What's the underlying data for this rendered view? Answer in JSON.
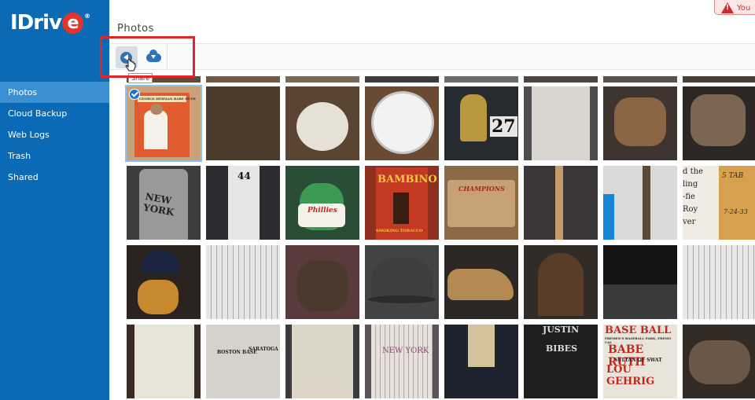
{
  "brand": {
    "logo_text": "IDriv",
    "logo_e": "e",
    "logo_reg": "®"
  },
  "sidebar": {
    "items": [
      {
        "label": "Photos",
        "active": true
      },
      {
        "label": "Cloud Backup",
        "active": false
      },
      {
        "label": "Web Logs",
        "active": false
      },
      {
        "label": "Trash",
        "active": false
      },
      {
        "label": "Shared",
        "active": false
      }
    ]
  },
  "header": {
    "title": "Photos",
    "alert_text": "You"
  },
  "toolbar": {
    "share_icon": "share-icon",
    "download_icon": "cloud-download-icon",
    "tooltip": "Share"
  },
  "colors": {
    "sidebar": "#0a6ab5",
    "sidebar_active": "#3c8fd1",
    "accent": "#1d73c9",
    "highlight": "#e0262b"
  },
  "photo_text": {
    "r1c1_card": "GEORGE HERMAN BABE RUTH",
    "r1c5_number": "27",
    "r2c1_text": "NEW YORK",
    "r2c2_number": "44",
    "r2c3_text": "Phillies",
    "r2c4_top": "BAMBINO",
    "r2c4_bottom": "SMOKING TOBACCO",
    "r2c5_text": "CHAMPIONS",
    "r2c8_line1": "d the",
    "r2c8_line2": "ling",
    "r2c8_line3": "-fie",
    "r2c8_line4": "Roy",
    "r2c8_line5": "ver",
    "r2c9_line1": "5  TAB",
    "r2c9_line2": "7-24-33",
    "r4c3_text": "BOSTON BASE",
    "r4c4_text": "SARATOGA",
    "r4c5_text": "NEW YORK",
    "r4c7_line1": "JUSTIN",
    "r4c7_line2": "BIBES",
    "r4c8_line1": "BASE BALL",
    "r4c8_line2": "FREMEN'S BASEBALL PARK, FREMO CAL",
    "r4c8_line3": "BABE RUTH",
    "r4c8_line4": "SULTAN OF SWAT",
    "r4c8_line5": "LOU GEHRIG"
  },
  "photos": [
    {
      "row": 0,
      "col": 0,
      "bg": "#c9a27a",
      "selected": true
    },
    {
      "row": 0,
      "col": 1,
      "bg": "#4a3b2d"
    },
    {
      "row": 0,
      "col": 2,
      "bg": "#5a4432"
    },
    {
      "row": 0,
      "col": 3,
      "bg": "#6b4a33"
    },
    {
      "row": 0,
      "col": 4,
      "bg": "#262b30"
    },
    {
      "row": 0,
      "col": 5,
      "bg": "#4d4d4d"
    },
    {
      "row": 0,
      "col": 6,
      "bg": "#3e3530"
    },
    {
      "row": 0,
      "col": 7,
      "bg": "#2d2825"
    },
    {
      "row": 1,
      "col": 0,
      "bg": "#3d3d3d"
    },
    {
      "row": 1,
      "col": 1,
      "bg": "#2c2c30"
    },
    {
      "row": 1,
      "col": 2,
      "bg": "#2a4d36"
    },
    {
      "row": 1,
      "col": 3,
      "bg": "#8e2f1f"
    },
    {
      "row": 1,
      "col": 4,
      "bg": "#8c6a46"
    },
    {
      "row": 1,
      "col": 5,
      "bg": "#3b3738"
    },
    {
      "row": 1,
      "col": 6,
      "bg": "#d9dad7"
    },
    {
      "row": 1,
      "col": 7,
      "bg": "#e8e2d6"
    },
    {
      "row": 2,
      "col": 0,
      "bg": "#2a2320"
    },
    {
      "row": 2,
      "col": 1,
      "bg": "#3a3a3a"
    },
    {
      "row": 2,
      "col": 2,
      "bg": "#5a3a3a"
    },
    {
      "row": 2,
      "col": 3,
      "bg": "#414344"
    },
    {
      "row": 2,
      "col": 4,
      "bg": "#2c2826"
    },
    {
      "row": 2,
      "col": 5,
      "bg": "#312c27"
    },
    {
      "row": 2,
      "col": 6,
      "bg": "#151515"
    },
    {
      "row": 2,
      "col": 7,
      "bg": "#3c3c3c"
    },
    {
      "row": 3,
      "col": 0,
      "bg": "#3a2a28"
    },
    {
      "row": 3,
      "col": 1,
      "bg": "#2b2b2b"
    },
    {
      "row": 3,
      "col": 2,
      "bg": "#3c3a3a"
    },
    {
      "row": 3,
      "col": 3,
      "bg": "#5b5358"
    },
    {
      "row": 3,
      "col": 4,
      "bg": "#1d2430"
    },
    {
      "row": 3,
      "col": 5,
      "bg": "#1e1e1e"
    },
    {
      "row": 3,
      "col": 6,
      "bg": "#e9e4da"
    },
    {
      "row": 3,
      "col": 7,
      "bg": "#332b25"
    }
  ]
}
